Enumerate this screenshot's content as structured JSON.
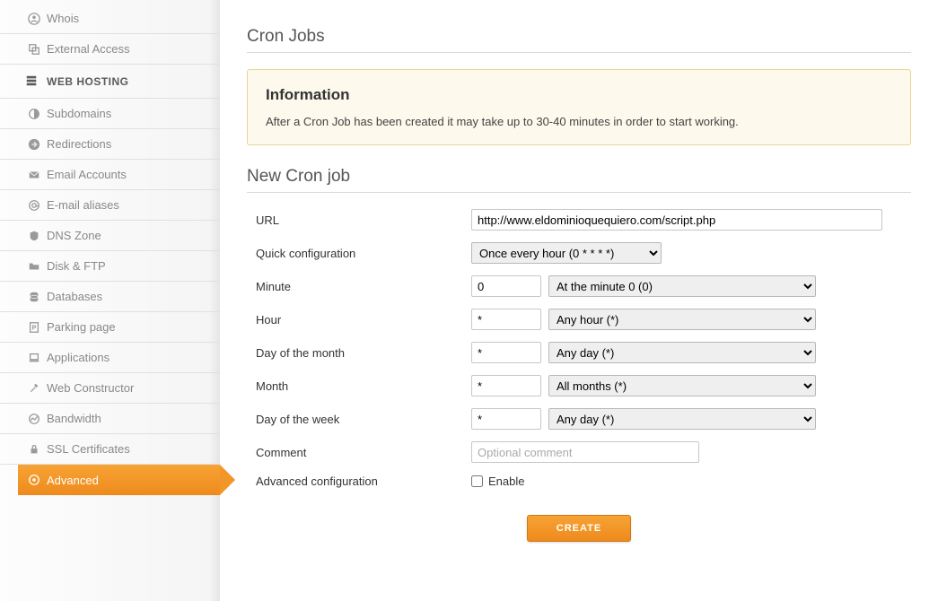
{
  "sidebar": {
    "items": [
      {
        "label": "Whois",
        "icon": "user-circle-icon"
      },
      {
        "label": "External Access",
        "icon": "external-icon"
      }
    ],
    "section_header": "WEB HOSTING",
    "hosting_items": [
      {
        "label": "Subdomains",
        "icon": "half-circle-icon"
      },
      {
        "label": "Redirections",
        "icon": "arrow-circle-icon"
      },
      {
        "label": "Email Accounts",
        "icon": "mail-icon"
      },
      {
        "label": "E-mail aliases",
        "icon": "at-icon"
      },
      {
        "label": "DNS Zone",
        "icon": "shield-icon"
      },
      {
        "label": "Disk & FTP",
        "icon": "folder-icon"
      },
      {
        "label": "Databases",
        "icon": "database-icon"
      },
      {
        "label": "Parking page",
        "icon": "page-icon"
      },
      {
        "label": "Applications",
        "icon": "laptop-icon"
      },
      {
        "label": "Web Constructor",
        "icon": "hammer-icon"
      },
      {
        "label": "Bandwidth",
        "icon": "chart-icon"
      },
      {
        "label": "SSL Certificates",
        "icon": "lock-icon"
      },
      {
        "label": "Advanced",
        "icon": "gear-circle-icon"
      }
    ]
  },
  "main": {
    "section1_title": "Cron Jobs",
    "info_heading": "Information",
    "info_text": "After a Cron Job has been created it may take up to 30-40 minutes in order to start working.",
    "section2_title": "New Cron job",
    "form": {
      "url_label": "URL",
      "url_value": "http://www.eldominioquequiero.com/script.php",
      "quick_label": "Quick configuration",
      "quick_value": "Once every hour (0 * * * *)",
      "minute_label": "Minute",
      "minute_value": "0",
      "minute_select": "At the minute 0 (0)",
      "hour_label": "Hour",
      "hour_value": "*",
      "hour_select": "Any hour (*)",
      "dom_label": "Day of the month",
      "dom_value": "*",
      "dom_select": "Any day (*)",
      "month_label": "Month",
      "month_value": "*",
      "month_select": "All months (*)",
      "dow_label": "Day of the week",
      "dow_value": "*",
      "dow_select": "Any day (*)",
      "comment_label": "Comment",
      "comment_placeholder": "Optional comment",
      "adv_label": "Advanced configuration",
      "enable_label": "Enable",
      "create_btn": "CREATE"
    }
  }
}
